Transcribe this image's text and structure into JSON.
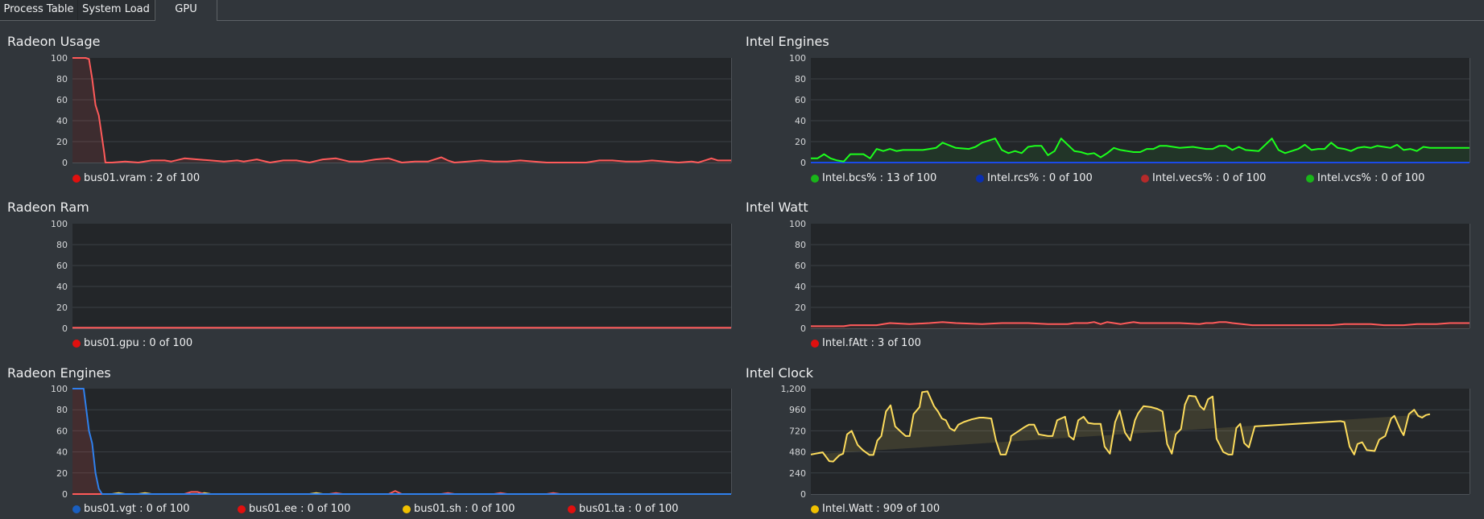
{
  "tabs": [
    {
      "label": "Process Table",
      "active": false
    },
    {
      "label": "System Load",
      "active": false
    },
    {
      "label": "GPU",
      "active": true
    }
  ],
  "colors": {
    "background": "#31363b",
    "plot_background": "#232629",
    "grid": "#3b4045",
    "red_line": "#ff5a5a",
    "green_line": "#1cff1c",
    "blue_line": "#1c6ef0",
    "yellow_line": "#fddc5c"
  },
  "chart_data": [
    {
      "id": "radeon-usage",
      "type": "area",
      "title": "Radeon Usage",
      "ylim": [
        0,
        100
      ],
      "yticks": [
        "0",
        "20",
        "40",
        "60",
        "80",
        "100"
      ],
      "grid": true,
      "legend_placement": "bottom-left",
      "series": [
        {
          "name": "bus01.vram",
          "legend": "bus01.vram : 2 of 100",
          "dot_color": "#e0100f",
          "line_color": "#ff5a5a",
          "fill": "rgba(255,90,90,0.12)",
          "x": [
            0,
            1.2,
            1.5,
            2,
            2.5,
            3,
            3.5,
            4,
            4.8,
            5,
            6,
            8,
            10,
            12,
            14,
            15,
            17,
            19,
            21,
            23,
            25,
            26,
            28,
            30,
            32,
            34,
            36,
            38,
            40,
            42,
            44,
            46,
            48,
            50,
            52,
            54,
            56,
            57,
            58,
            60,
            62,
            64,
            66,
            68,
            70,
            72,
            74,
            76,
            78,
            80,
            82,
            84,
            86,
            88,
            90,
            92,
            94,
            95,
            96,
            97,
            98,
            99,
            100
          ],
          "values": [
            100,
            100,
            100,
            100,
            99,
            80,
            55,
            45,
            10,
            0,
            0,
            1,
            0,
            2,
            2,
            1,
            4,
            3,
            2,
            1,
            2,
            1,
            3,
            0,
            2,
            2,
            0,
            3,
            4,
            1,
            1,
            3,
            4,
            0,
            1,
            1,
            5,
            2,
            0,
            1,
            2,
            1,
            1,
            2,
            1,
            0,
            0,
            0,
            0,
            2,
            2,
            1,
            1,
            2,
            1,
            0,
            1,
            0,
            2,
            4,
            2,
            2,
            2
          ]
        }
      ]
    },
    {
      "id": "radeon-ram",
      "type": "line",
      "title": "Radeon Ram",
      "ylim": [
        0,
        100
      ],
      "yticks": [
        "0",
        "20",
        "40",
        "60",
        "80",
        "100"
      ],
      "grid": true,
      "legend_placement": "bottom-left",
      "series": [
        {
          "name": "bus01.gpu",
          "legend": "bus01.gpu : 0 of 100",
          "dot_color": "#e0100f",
          "line_color": "#ff5a5a",
          "fill": "none",
          "x": [
            0,
            100
          ],
          "values": [
            0.5,
            0.5
          ]
        }
      ]
    },
    {
      "id": "radeon-engines",
      "type": "area",
      "title": "Radeon Engines",
      "ylim": [
        0,
        100
      ],
      "yticks": [
        "0",
        "20",
        "40",
        "60",
        "80",
        "100"
      ],
      "grid": true,
      "legend_placement": "bottom-left",
      "series": [
        {
          "name": "bus01.vgt",
          "legend": "bus01.vgt : 0 of 100",
          "dot_color": "#1a5fc0",
          "line_color": "#2f80ed",
          "fill": "rgba(255,90,90,0.15)",
          "x": [
            0,
            1.7,
            2,
            2.5,
            3,
            3.5,
            4,
            4.5,
            5,
            100
          ],
          "values": [
            100,
            100,
            85,
            60,
            48,
            20,
            5,
            0,
            0,
            0
          ]
        },
        {
          "name": "bus01.ee",
          "legend": "bus01.ee : 0 of 100",
          "dot_color": "#e0100f",
          "line_color": "#ff5a5a",
          "fill": "none",
          "x": [
            0,
            17,
            18,
            19,
            20,
            39,
            40,
            41,
            48,
            49,
            50,
            56,
            57,
            58,
            64,
            65,
            66,
            72,
            73,
            74,
            100
          ],
          "values": [
            0,
            0,
            2,
            2,
            0,
            0,
            1,
            0,
            0,
            3,
            0,
            0,
            1,
            0,
            0,
            1,
            0,
            0,
            1,
            0,
            0
          ]
        },
        {
          "name": "bus01.sh",
          "legend": "bus01.sh : 0 of 100",
          "dot_color": "#f0c000",
          "line_color": "#fddc5c",
          "fill": "none",
          "x": [
            0,
            6,
            7,
            8,
            10,
            11,
            12,
            19,
            20,
            21,
            36,
            37,
            38,
            100
          ],
          "values": [
            0,
            0,
            1,
            0,
            0,
            1,
            0,
            0,
            1,
            0,
            0,
            1,
            0,
            0
          ]
        },
        {
          "name": "bus01.ta",
          "legend": "bus01.ta : 0 of 100",
          "dot_color": "#e0100f",
          "line_color": "#ff5a5a",
          "fill": "none",
          "x": [
            0,
            100
          ],
          "values": [
            0,
            0
          ]
        }
      ]
    },
    {
      "id": "intel-engines",
      "type": "area",
      "title": "Intel Engines",
      "ylim": [
        0,
        100
      ],
      "yticks": [
        "0",
        "20",
        "40",
        "60",
        "80",
        "100"
      ],
      "grid": true,
      "legend_placement": "bottom-left",
      "series": [
        {
          "name": "Intel.bcs%",
          "legend": "Intel.bcs% : 13 of 100",
          "dot_color": "#19b519",
          "line_color": "#1cff1c",
          "fill": "rgba(28,255,28,0.07)",
          "x": [
            0,
            1,
            2,
            3,
            4,
            5,
            6,
            8,
            9,
            10,
            11,
            12,
            13,
            14,
            15,
            16,
            17,
            18,
            19,
            20,
            22,
            24,
            25,
            26,
            27,
            28,
            29,
            30,
            31,
            32,
            33,
            34,
            35,
            36,
            37,
            38,
            40,
            41,
            42,
            43,
            44,
            45,
            46,
            47,
            48,
            49,
            50,
            51,
            52,
            53,
            54,
            55,
            56,
            58,
            60,
            61,
            62,
            63,
            64,
            65,
            66,
            68,
            70,
            71,
            72,
            74,
            75,
            76,
            77,
            78,
            79,
            80,
            81,
            82,
            83,
            84,
            85,
            86,
            87,
            88,
            89,
            90,
            91,
            92,
            93,
            94,
            95,
            96,
            97,
            98,
            99,
            100
          ],
          "values": [
            4,
            4,
            8,
            4,
            2,
            1,
            8,
            8,
            4,
            13,
            11,
            13,
            11,
            12,
            12,
            12,
            12,
            13,
            14,
            19,
            14,
            13,
            15,
            19,
            21,
            23,
            12,
            9,
            11,
            9,
            15,
            16,
            16,
            7,
            11,
            23,
            11,
            10,
            8,
            9,
            5,
            9,
            14,
            12,
            11,
            10,
            10,
            13,
            13,
            16,
            16,
            15,
            14,
            15,
            13,
            13,
            16,
            16,
            12,
            15,
            12,
            11,
            23,
            12,
            9,
            13,
            17,
            12,
            13,
            13,
            19,
            14,
            13,
            11,
            14,
            15,
            14,
            16,
            15,
            14,
            17,
            12,
            13,
            11,
            15,
            14,
            14,
            14,
            14,
            14,
            14,
            14
          ]
        },
        {
          "name": "Intel.rcs%",
          "legend": "Intel.rcs% : 0 of 100",
          "dot_color": "#0a2fb0",
          "line_color": "#1a44f0",
          "fill": "none",
          "x": [
            0,
            100
          ],
          "values": [
            0,
            0
          ]
        },
        {
          "name": "Intel.vecs%",
          "legend": "Intel.vecs% : 0 of 100",
          "dot_color": "#b52a2a",
          "line_color": "#b52a2a",
          "fill": "none",
          "x": [
            0,
            100
          ],
          "values": [
            0,
            0
          ]
        },
        {
          "name": "Intel.vcs%",
          "legend": "Intel.vcs% : 0 of 100",
          "dot_color": "#19b519",
          "line_color": "#19b519",
          "fill": "none",
          "x": [
            0,
            100
          ],
          "values": [
            0,
            0
          ]
        }
      ]
    },
    {
      "id": "intel-watt",
      "type": "area",
      "title": "Intel Watt",
      "ylim": [
        0,
        100
      ],
      "yticks": [
        "0",
        "20",
        "40",
        "60",
        "80",
        "100"
      ],
      "grid": true,
      "legend_placement": "bottom-left",
      "series": [
        {
          "name": "Intel.fAtt",
          "legend": "Intel.fAtt : 3 of 100",
          "dot_color": "#e0100f",
          "line_color": "#ff5a5a",
          "fill": "rgba(255,90,90,0.08)",
          "x": [
            0,
            5,
            6,
            10,
            11,
            12,
            15,
            18,
            20,
            22,
            26,
            29,
            30,
            33,
            36,
            39,
            40,
            41,
            42,
            43,
            44,
            45,
            47,
            48,
            49,
            50,
            53,
            56,
            59,
            60,
            61,
            62,
            63,
            64,
            67,
            72,
            73,
            76,
            78,
            79,
            81,
            83,
            85,
            87,
            90,
            92,
            95,
            97,
            100
          ],
          "values": [
            2,
            2,
            3,
            3,
            4,
            5,
            4,
            5,
            6,
            5,
            4,
            5,
            5,
            5,
            4,
            4,
            5,
            5,
            5,
            6,
            4,
            6,
            4,
            5,
            6,
            5,
            5,
            5,
            4,
            5,
            5,
            6,
            6,
            5,
            3,
            3,
            3,
            3,
            3,
            3,
            4,
            4,
            4,
            3,
            3,
            4,
            4,
            5,
            5
          ]
        }
      ]
    },
    {
      "id": "intel-clock",
      "type": "area",
      "title": "Intel Clock",
      "ylim": [
        0,
        1200
      ],
      "yticks": [
        "0",
        "240",
        "480",
        "720",
        "960",
        "1,200"
      ],
      "grid": true,
      "legend_placement": "bottom-left",
      "series": [
        {
          "name": "Intel.Watt",
          "legend": "Intel.Watt : 909 of 100",
          "dot_color": "#f0c000",
          "line_color": "#fddc5c",
          "fill": "rgba(253,220,92,0.12)",
          "x": [
            0,
            1.8,
            2.8,
            3.4,
            4.3,
            4.9,
            5.5,
            6.2,
            7.1,
            7.9,
            8.9,
            9.5,
            10.1,
            10.7,
            11.4,
            12.1,
            12.8,
            13.8,
            14.4,
            15.0,
            15.6,
            16.5,
            16.9,
            17.7,
            18.7,
            19.3,
            19.9,
            20.5,
            21.1,
            21.8,
            22.4,
            23.2,
            24.4,
            25.6,
            26.2,
            27.4,
            28.1,
            28.8,
            29.6,
            30.3,
            30.4,
            32.4,
            33.1,
            33.9,
            34.6,
            36.0,
            36.7,
            37.4,
            38.6,
            39.2,
            39.9,
            40.6,
            41.4,
            42.1,
            43.0,
            44.0,
            44.6,
            45.4,
            46.2,
            46.9,
            47.7,
            48.5,
            49.2,
            49.7,
            50.5,
            51.6,
            52.6,
            53.4,
            54.1,
            54.8,
            55.4,
            56.2,
            56.8,
            57.4,
            58.4,
            59.1,
            59.7,
            60.3,
            61.0,
            61.6,
            62.6,
            63.4,
            64.0,
            64.6,
            65.2,
            65.8,
            66.5,
            67.4,
            80.4,
            81.0,
            81.8,
            82.5,
            83.0,
            83.7,
            84.4,
            85.6,
            86.3,
            87.2,
            88.1,
            88.6,
            89.6,
            90.0,
            90.8,
            91.6,
            92.2,
            92.8,
            93.4,
            94.0,
            94.9,
            95.8,
            96.6,
            97.2,
            98.8,
            100
          ],
          "values": [
            450,
            475,
            375,
            370,
            440,
            460,
            680,
            720,
            560,
            500,
            445,
            445,
            610,
            660,
            940,
            1010,
            770,
            700,
            660,
            660,
            910,
            990,
            1160,
            1170,
            1000,
            940,
            860,
            840,
            750,
            720,
            790,
            820,
            850,
            870,
            870,
            860,
            610,
            450,
            450,
            610,
            660,
            760,
            790,
            790,
            680,
            660,
            660,
            840,
            880,
            660,
            620,
            840,
            880,
            810,
            800,
            800,
            540,
            460,
            820,
            950,
            700,
            610,
            840,
            920,
            1000,
            990,
            970,
            940,
            570,
            460,
            680,
            740,
            1020,
            1120,
            1110,
            1000,
            960,
            1080,
            1110,
            630,
            480,
            450,
            450,
            750,
            800,
            580,
            530,
            770,
            830,
            820,
            540,
            450,
            570,
            590,
            500,
            490,
            620,
            660,
            860,
            890,
            720,
            670,
            910,
            960,
            890,
            870,
            900,
            910
          ]
        }
      ]
    }
  ]
}
